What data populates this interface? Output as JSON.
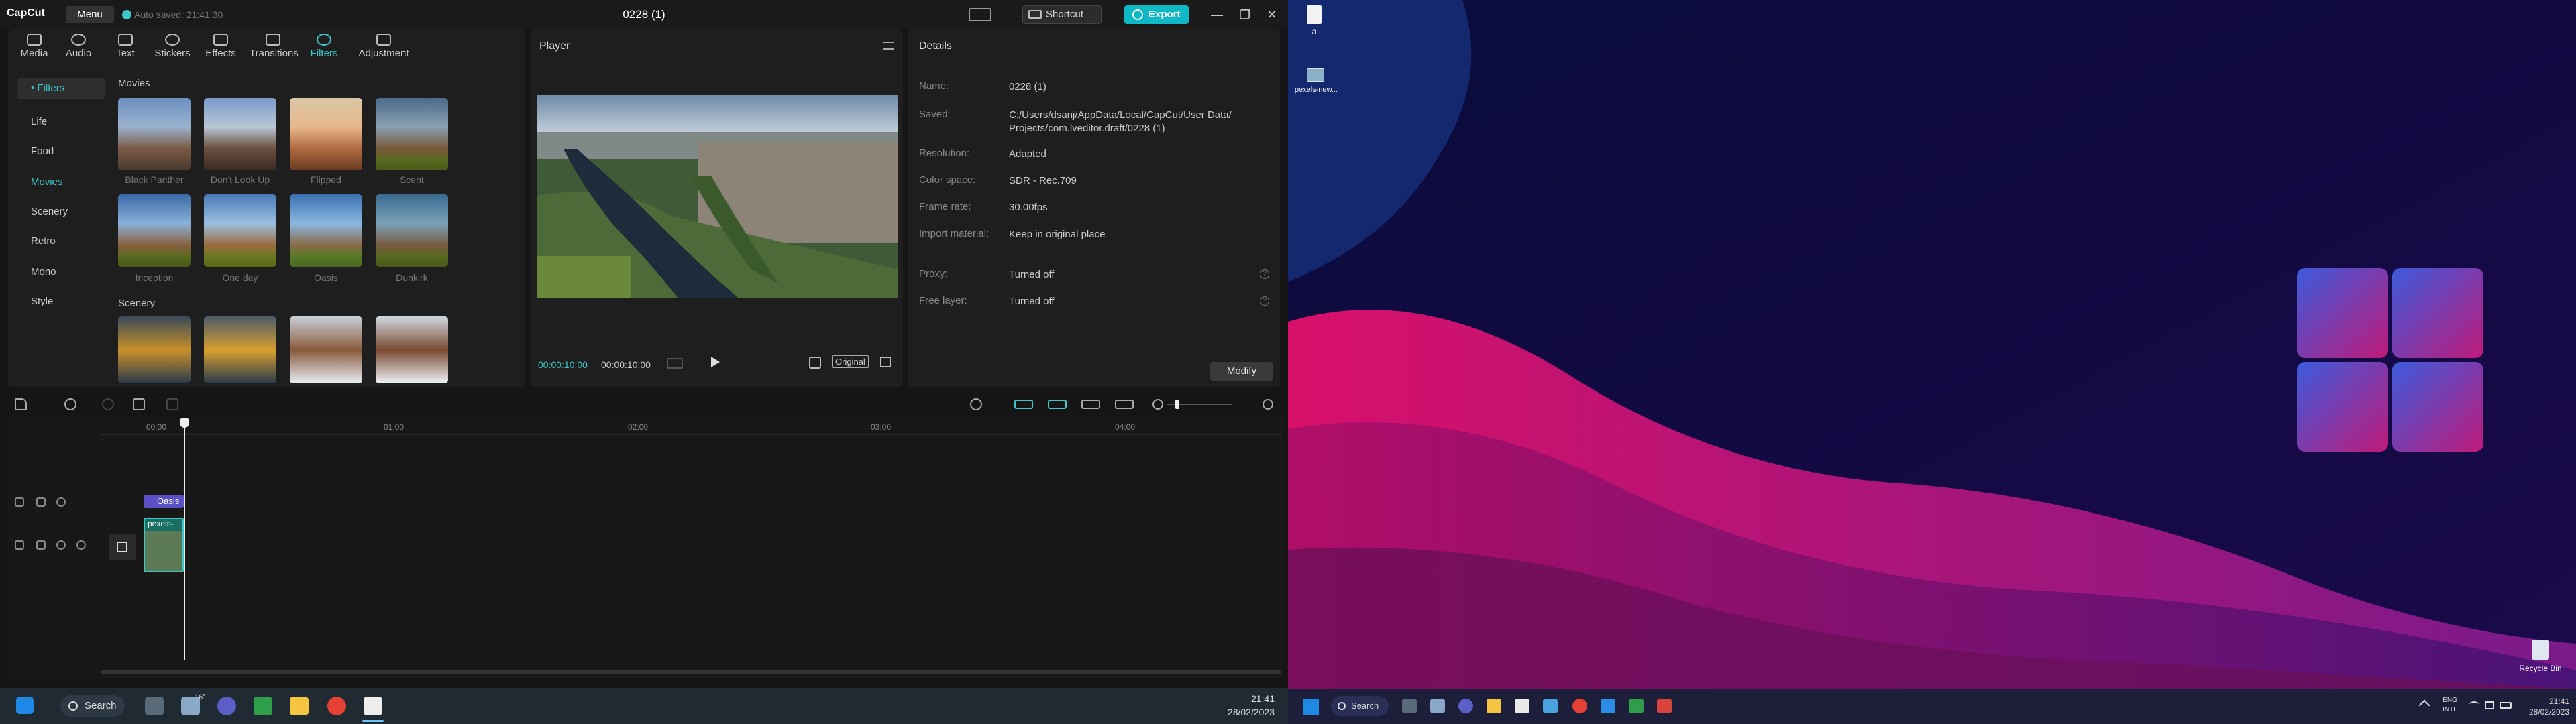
{
  "app": {
    "logo": "CapCut",
    "menu_label": "Menu",
    "autosave": "Auto saved: 21:41:30",
    "project_title": "0228 (1)",
    "shortcut_label": "Shortcut",
    "export_label": "Export"
  },
  "toolbar_tabs": [
    {
      "label": "Media",
      "icon": "media-icon"
    },
    {
      "label": "Audio",
      "icon": "audio-icon"
    },
    {
      "label": "Text",
      "icon": "text-icon"
    },
    {
      "label": "Stickers",
      "icon": "stickers-icon"
    },
    {
      "label": "Effects",
      "icon": "effects-icon"
    },
    {
      "label": "Transitions",
      "icon": "transitions-icon"
    },
    {
      "label": "Filters",
      "icon": "filters-icon",
      "active": true
    },
    {
      "label": "Adjustment",
      "icon": "adjustment-icon"
    }
  ],
  "filter_categories": [
    "• Filters",
    "Life",
    "Food",
    "Movies",
    "Scenery",
    "Retro",
    "Mono",
    "Style"
  ],
  "movies_section": {
    "title": "Movies",
    "items": [
      "Black Panther",
      "Don't Look Up",
      "Flipped",
      "Scent",
      "Inception",
      "One day",
      "Oasis",
      "Dunkirk"
    ]
  },
  "scenery_section": {
    "title": "Scenery"
  },
  "player": {
    "title": "Player",
    "current_time": "00:00:10:00",
    "total_time": "00:00:10:00",
    "original_label": "Original"
  },
  "details": {
    "title": "Details",
    "rows": [
      {
        "label": "Name:",
        "value": "0228 (1)"
      },
      {
        "label": "Saved:",
        "value": "C:/Users/dsanj/AppData/Local/CapCut/User Data/ Projects/com.lveditor.draft/0228 (1)"
      },
      {
        "label": "Resolution:",
        "value": "Adapted"
      },
      {
        "label": "Color space:",
        "value": "SDR - Rec.709"
      },
      {
        "label": "Frame rate:",
        "value": "30.00fps"
      },
      {
        "label": "Import material:",
        "value": "Keep in original place"
      },
      {
        "label": "Proxy:",
        "value": "Turned off"
      },
      {
        "label": "Free layer:",
        "value": "Turned off"
      }
    ],
    "modify_label": "Modify"
  },
  "timeline": {
    "ruler": [
      "00:00",
      "01:00",
      "02:00",
      "03:00",
      "04:00"
    ],
    "filter_clip": "Oasis",
    "video_clip": "pexels-"
  },
  "taskbar_left": {
    "search_label": "Search",
    "weather": "16°",
    "time": "21:41",
    "date": "28/02/2023"
  },
  "desktop": {
    "icon1_label": "a",
    "icon2_label": "pexels-new...",
    "recycle_bin": "Recycle Bin"
  },
  "taskbar_right": {
    "search_label": "Search",
    "lang1": "ENG",
    "lang2": "INTL",
    "time": "21:41",
    "date": "28/02/2023"
  },
  "colors": {
    "accent": "#3ec7c9",
    "export": "#0fb8c5",
    "filter_clip": "#5a4fc4"
  }
}
